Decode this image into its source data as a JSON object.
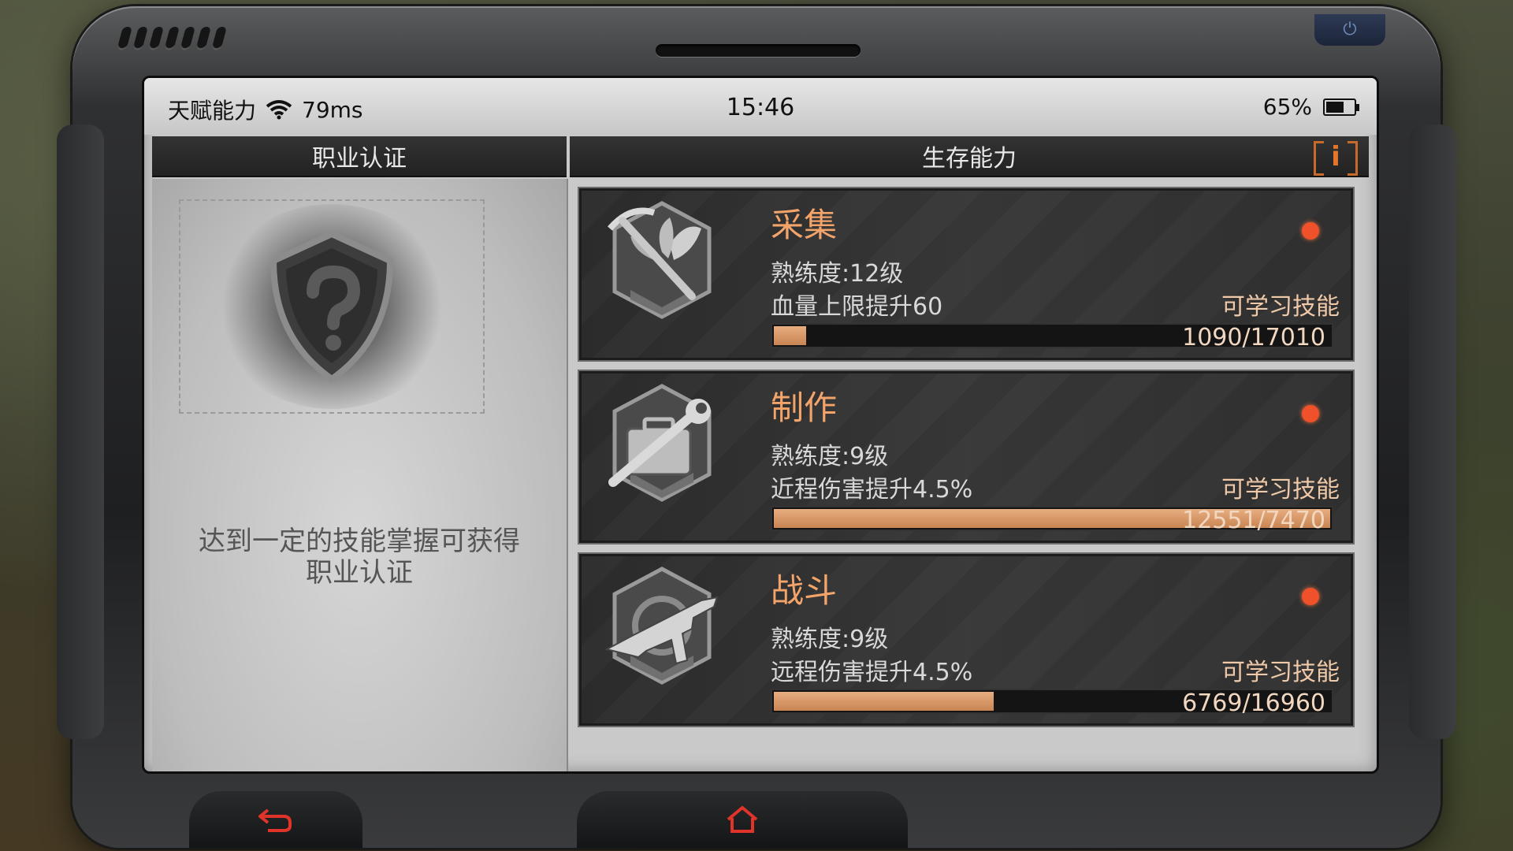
{
  "status_bar": {
    "app_label": "天赋能力",
    "ping": "79ms",
    "time": "15:46",
    "battery": "65%",
    "battery_level": 0.65
  },
  "tabs": {
    "left": "职业认证",
    "right": "生存能力"
  },
  "info_button": "i",
  "cert_panel": {
    "emblem_icon": "question-shield-icon",
    "message_line1": "达到一定的技能掌握可获得",
    "message_line2": "职业认证"
  },
  "skills": [
    {
      "title": "采集",
      "level": "熟练度:12级",
      "bonus": "血量上限提升60",
      "learn": "可学习技能",
      "progress": "1090/17010",
      "progress_fraction": 0.064,
      "icon": "pickaxe-leaf-emblem-icon"
    },
    {
      "title": "制作",
      "level": "熟练度:9级",
      "bonus": "近程伤害提升4.5%",
      "learn": "可学习技能",
      "progress": "12551/7470",
      "progress_fraction": 1.0,
      "icon": "wrench-toolbox-emblem-icon"
    },
    {
      "title": "战斗",
      "level": "熟练度:9级",
      "bonus": "远程伤害提升4.5%",
      "learn": "可学习技能",
      "progress": "6769/16960",
      "progress_fraction": 0.399,
      "icon": "submachine-gun-emblem-icon"
    }
  ],
  "colors": {
    "accent_orange": "#f3a46a",
    "alert_dot": "#f0502a",
    "bar_fill": "#c98553"
  }
}
